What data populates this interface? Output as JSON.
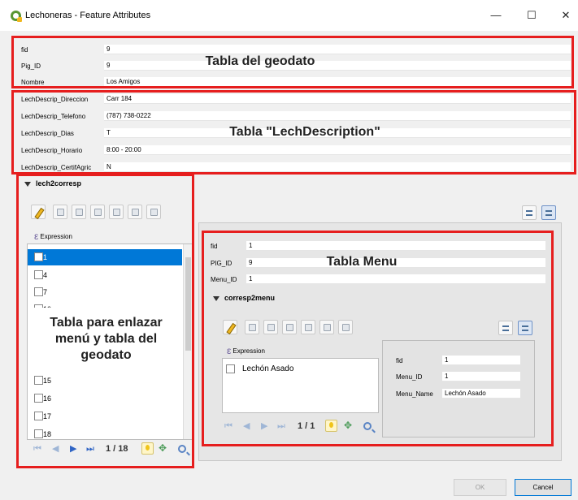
{
  "window": {
    "title": "Lechoneras - Feature Attributes",
    "minimize": "—",
    "maximize": "☐",
    "close": "✕"
  },
  "geo_fields": [
    {
      "label": "fid",
      "value": "9"
    },
    {
      "label": "Pig_ID",
      "value": "9"
    },
    {
      "label": "Nombre",
      "value": "Los Amigos"
    }
  ],
  "lech_fields": [
    {
      "label": "LechDescrip_Direccion",
      "value": "Carr 184"
    },
    {
      "label": "LechDescrip_Telefono",
      "value": "(787) 738-0222"
    },
    {
      "label": "LechDescrip_Dias",
      "value": "T"
    },
    {
      "label": "LechDescrip_Horario",
      "value": "8:00 - 20:00"
    },
    {
      "label": "LechDescrip_CertifAgric",
      "value": "N"
    }
  ],
  "annotations": {
    "geo": "Tabla del geodato",
    "lech": "Tabla \"LechDescription\"",
    "link": "Tabla para enlazar menú y tabla del geodato",
    "menu": "Tabla Menu"
  },
  "lech2corresp": {
    "title": "lech2corresp",
    "expression_label": "Expression",
    "items_top": [
      "1",
      "4",
      "7",
      "10"
    ],
    "items_bottom": [
      "15",
      "16",
      "17",
      "18"
    ],
    "selected": "1",
    "page": "1 / 18"
  },
  "menu_form": {
    "fields": [
      {
        "label": "fid",
        "value": "1"
      },
      {
        "label": "PIG_ID",
        "value": "9"
      },
      {
        "label": "Menu_ID",
        "value": "1"
      }
    ],
    "corresp2menu": {
      "title": "corresp2menu",
      "expression_label": "Expression",
      "items": [
        "Lechón Asado"
      ],
      "page": "1 / 1",
      "fields": [
        {
          "label": "fid",
          "value": "1"
        },
        {
          "label": "Menu_ID",
          "value": "1"
        },
        {
          "label": "Menu_Name",
          "value": "Lechón Asado"
        }
      ]
    }
  },
  "buttons": {
    "ok": "OK",
    "cancel": "Cancel"
  },
  "colors": {
    "annotation": "#e61e1e",
    "selection": "#0078d7",
    "qgis_green": "#589632"
  }
}
